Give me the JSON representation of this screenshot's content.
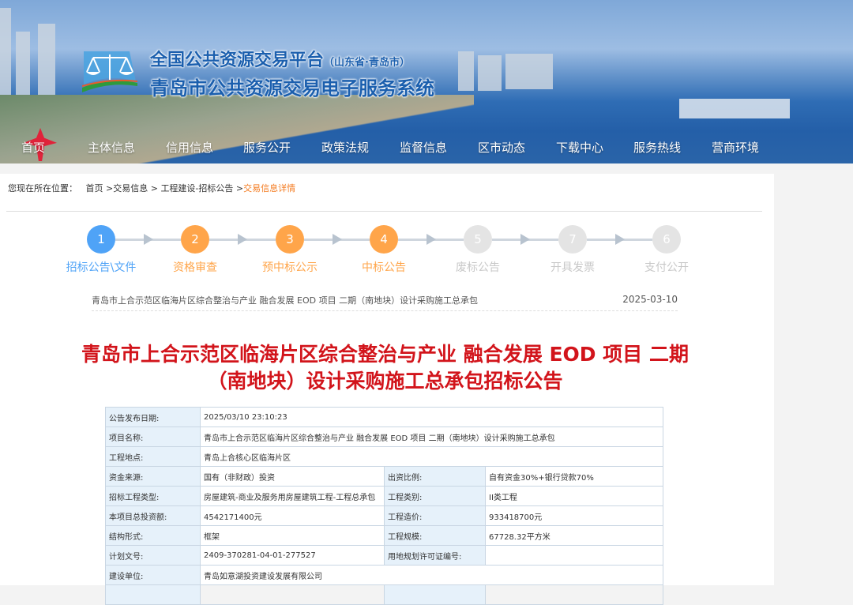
{
  "header": {
    "platform_title": "全国公共资源交易平台",
    "platform_region": "（山东省·青岛市）",
    "system_title": "青岛市公共资源交易电子服务系统"
  },
  "nav": [
    "首页",
    "主体信息",
    "信用信息",
    "服务公开",
    "政策法规",
    "监督信息",
    "区市动态",
    "下载中心",
    "服务热线",
    "营商环境"
  ],
  "breadcrumb": {
    "prefix": "您现在所在位置：",
    "items": [
      "首页",
      ">交易信息",
      ">",
      "工程建设-招标公告",
      ">"
    ],
    "current": "交易信息详情"
  },
  "steps": [
    {
      "num": "1",
      "label": "招标公告\\文件",
      "state": "active"
    },
    {
      "num": "2",
      "label": "资格审查",
      "state": "done"
    },
    {
      "num": "3",
      "label": "预中标公示",
      "state": "done"
    },
    {
      "num": "4",
      "label": "中标公告",
      "state": "done"
    },
    {
      "num": "5",
      "label": "废标公告",
      "state": "disabled"
    },
    {
      "num": "7",
      "label": "开具发票",
      "state": "disabled"
    },
    {
      "num": "6",
      "label": "支付公开",
      "state": "disabled"
    }
  ],
  "colors": {
    "active": "#4fa3f7",
    "done": "#ffa54a",
    "disabled": "#e4e4e4",
    "title": "#d2141b"
  },
  "list": {
    "title": "青岛市上合示范区临海片区综合整治与产业 融合发展 EOD 项目 二期（南地块）设计采购施工总承包",
    "date": "2025-03-10"
  },
  "article_title": "青岛市上合示范区临海片区综合整治与产业 融合发展 EOD 项目 二期（南地块）设计采购施工总承包招标公告",
  "table": {
    "publish_date": {
      "k": "公告发布日期:",
      "v": "2025/03/10 23:10:23"
    },
    "project_name": {
      "k": "项目名称:",
      "v": "青岛市上合示范区临海片区综合整治与产业 融合发展 EOD 项目 二期（南地块）设计采购施工总承包"
    },
    "location": {
      "k": "工程地点:",
      "v": "青岛上合核心区临海片区"
    },
    "rows": [
      {
        "k1": "资金来源:",
        "v1": "国有（非财政）投资",
        "k2": "出资比例:",
        "v2": "自有资金30%+银行贷款70%"
      },
      {
        "k1": "招标工程类型:",
        "v1": "房屋建筑-商业及服务用房屋建筑工程-工程总承包",
        "k2": "工程类别:",
        "v2": "II类工程"
      },
      {
        "k1": "本项目总投资额:",
        "v1": "4542171400元",
        "k2": "工程造价:",
        "v2": "933418700元"
      },
      {
        "k1": "结构形式:",
        "v1": "框架",
        "k2": "工程规模:",
        "v2": "67728.32平方米"
      },
      {
        "k1": "计划文号:",
        "v1": "2409-370281-04-01-277527",
        "k2": "用地规划许可证编号:",
        "v2": ""
      }
    ],
    "builder": {
      "k": "建设单位:",
      "v": "青岛如意湖投资建设发展有限公司"
    }
  }
}
